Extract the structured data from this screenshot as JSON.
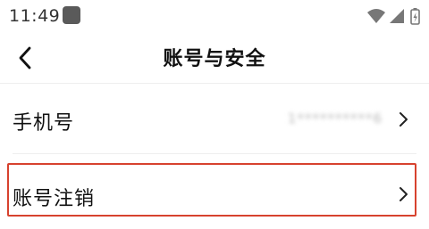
{
  "status_bar": {
    "time": "11:49",
    "icons": [
      "app-notification-icon",
      "wifi-icon",
      "cell-signal-icon",
      "battery-charging-icon"
    ]
  },
  "nav": {
    "title": "账号与安全",
    "back_icon": "chevron-left-icon"
  },
  "rows": [
    {
      "label": "手机号",
      "value": "1**********6",
      "value_blurred": true,
      "chevron": "chevron-right-icon"
    },
    {
      "label": "账号注销",
      "chevron": "chevron-right-icon",
      "highlighted": true
    }
  ],
  "colors": {
    "background": "#ffffff",
    "text": "#111111",
    "divider": "#eeeeee",
    "highlight": "#d7422e"
  }
}
